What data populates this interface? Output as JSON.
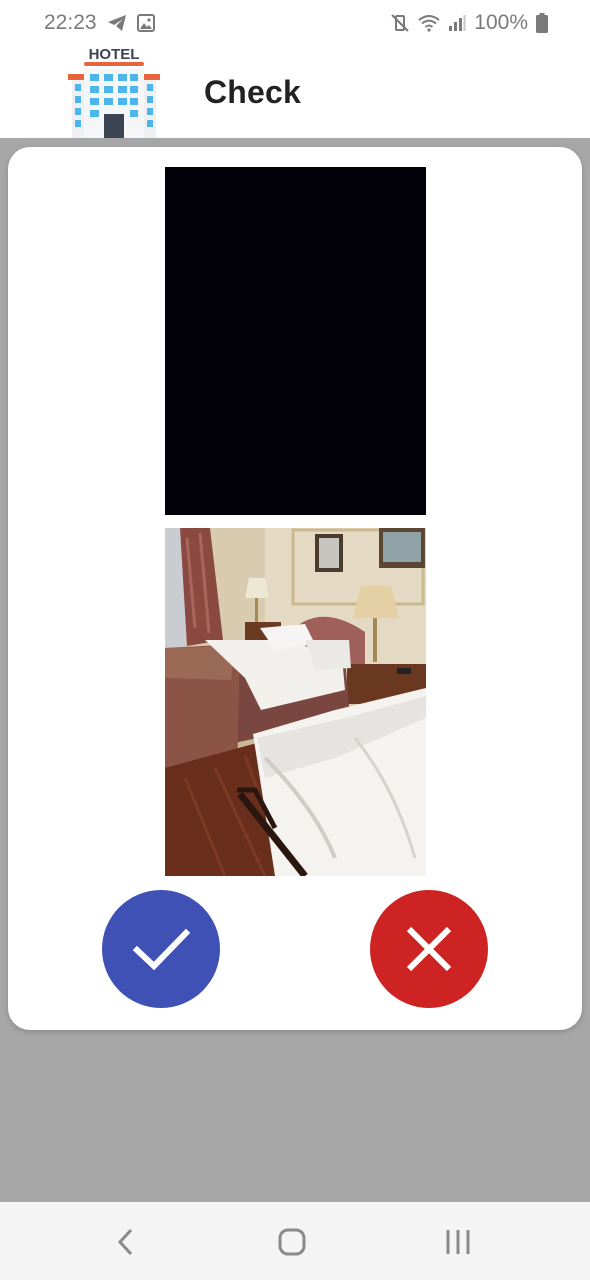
{
  "status_bar": {
    "time": "22:23",
    "battery_text": "100%",
    "left_icons": [
      "telegram-icon",
      "image-icon"
    ],
    "right_icons": [
      "mute-vibrate-icon",
      "wifi-icon",
      "signal-icon",
      "battery-icon"
    ]
  },
  "app_bar": {
    "logo_text": "HOTEL",
    "title": "Check"
  },
  "dialog": {
    "photos": [
      "front-photo",
      "room-photo"
    ],
    "confirm_icon": "checkmark-icon",
    "reject_icon": "close-icon",
    "colors": {
      "confirm": "#3f51b5",
      "reject": "#ce2323",
      "scrim": "#a7a7a7"
    }
  },
  "nav_bar": {
    "icons": [
      "back-icon",
      "home-icon",
      "recent-apps-icon"
    ]
  }
}
